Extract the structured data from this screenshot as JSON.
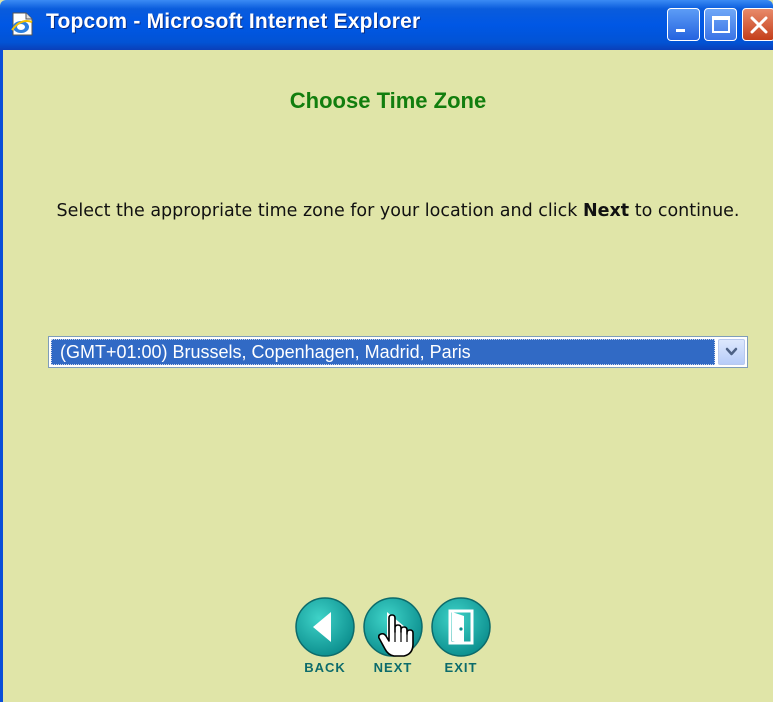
{
  "window": {
    "title": "Topcom - Microsoft Internet Explorer",
    "icon": "ie-page-icon",
    "controls": [
      "minimize-icon",
      "maximize-icon",
      "close-icon"
    ]
  },
  "page": {
    "heading": "Choose Time Zone",
    "instruction_before": "Select the appropriate time zone for your location and click ",
    "instruction_bold": "Next",
    "instruction_after": " to continue."
  },
  "timezone_select": {
    "value": "(GMT+01:00) Brussels, Copenhagen, Madrid, Paris",
    "arrow_icon": "chevron-down-icon"
  },
  "nav": {
    "back_label": "BACK",
    "next_label": "NEXT",
    "exit_label": "EXIT"
  },
  "colors": {
    "background": "#E0E5A8",
    "heading": "#127E0E",
    "button_teal": "#12A0A0",
    "selection": "#316AC5"
  }
}
